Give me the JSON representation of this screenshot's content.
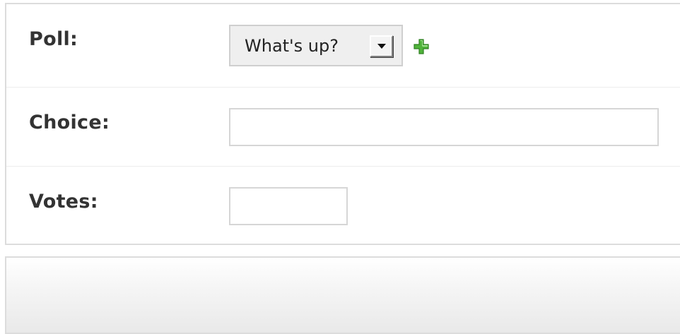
{
  "form": {
    "poll": {
      "label": "Poll:",
      "selected_value": "What's up?",
      "add_icon": "plus-icon",
      "add_icon_color": "#3c9a2a"
    },
    "choice": {
      "label": "Choice:",
      "value": "",
      "placeholder": ""
    },
    "votes": {
      "label": "Votes:",
      "value": "",
      "placeholder": ""
    }
  },
  "colors": {
    "label_text": "#333333",
    "border": "#dcdcdc",
    "select_background": "#efefef"
  }
}
